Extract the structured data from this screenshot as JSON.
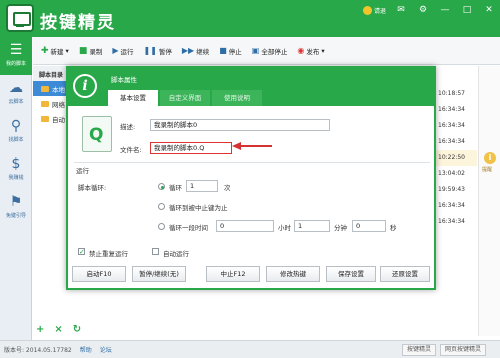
{
  "app": {
    "title": "按键精灵",
    "user": "请退",
    "header_icons": [
      "coin-icon",
      "mail-icon",
      "gear-icon",
      "minimize-icon",
      "maximize-icon",
      "close-icon"
    ]
  },
  "sidebar": {
    "items": [
      {
        "label": "我的脚本",
        "icon": "list-icon"
      },
      {
        "label": "云脚本",
        "icon": "cloud-icon"
      },
      {
        "label": "找脚本",
        "icon": "search-icon"
      },
      {
        "label": "我赚钱",
        "icon": "dollar-icon"
      },
      {
        "label": "免键引导",
        "icon": "signpost-icon"
      }
    ]
  },
  "toolbar": {
    "new": "新建",
    "record": "录制",
    "run": "运行",
    "pause": "暂停",
    "resume": "继续",
    "stop": "停止",
    "stop_all": "全部停止",
    "publish": "发布"
  },
  "tree": {
    "header": "脚本目录",
    "items": [
      {
        "label": "本地"
      },
      {
        "label": "网络"
      },
      {
        "label": "自动"
      }
    ]
  },
  "times": [
    "10:18:57",
    "16:34:34",
    "16:34:34",
    "16:34:34",
    "10:22:50",
    "13:04:02",
    "19:59:43",
    "16:34:34",
    "16:34:34"
  ],
  "side_alert": {
    "label": "提醒"
  },
  "dialog": {
    "title": "脚本属性",
    "tabs": [
      "基本设置",
      "自定义界面",
      "使用说明"
    ],
    "desc_label": "描述:",
    "desc_value": "我录制的脚本0",
    "file_label": "文件名:",
    "file_value": "我录制的脚本0.Q",
    "run_section": "运行",
    "loop_label": "脚本循环:",
    "loop_option": "循环",
    "loop_count": "1",
    "loop_unit": "次",
    "loop_until": "循环到被中止键为止",
    "loop_time": "循环一段时间",
    "loop_time_h": "0",
    "loop_time_h_unit": "小时",
    "loop_time_m": "1",
    "loop_time_m_unit": "分钟",
    "loop_time_s": "0",
    "loop_time_s_unit": "秒",
    "no_repeat": "禁止重复运行",
    "auto_run": "自动运行",
    "buttons": [
      "启动F10",
      "暂停/继续(无)",
      "中止F12",
      "修改热键",
      "保存设置",
      "还原设置"
    ]
  },
  "list_actions": [
    "+",
    "×",
    "↻"
  ],
  "status": {
    "version": "版本号: 2014.05.17782",
    "help": "帮助",
    "forum": "论坛",
    "btn_right1": "按键精灵",
    "btn_right2": "网页按键精灵"
  },
  "colors": {
    "brand_green": "#29a84a",
    "highlight_red": "#d33333",
    "link_blue": "#2f6ea5"
  }
}
